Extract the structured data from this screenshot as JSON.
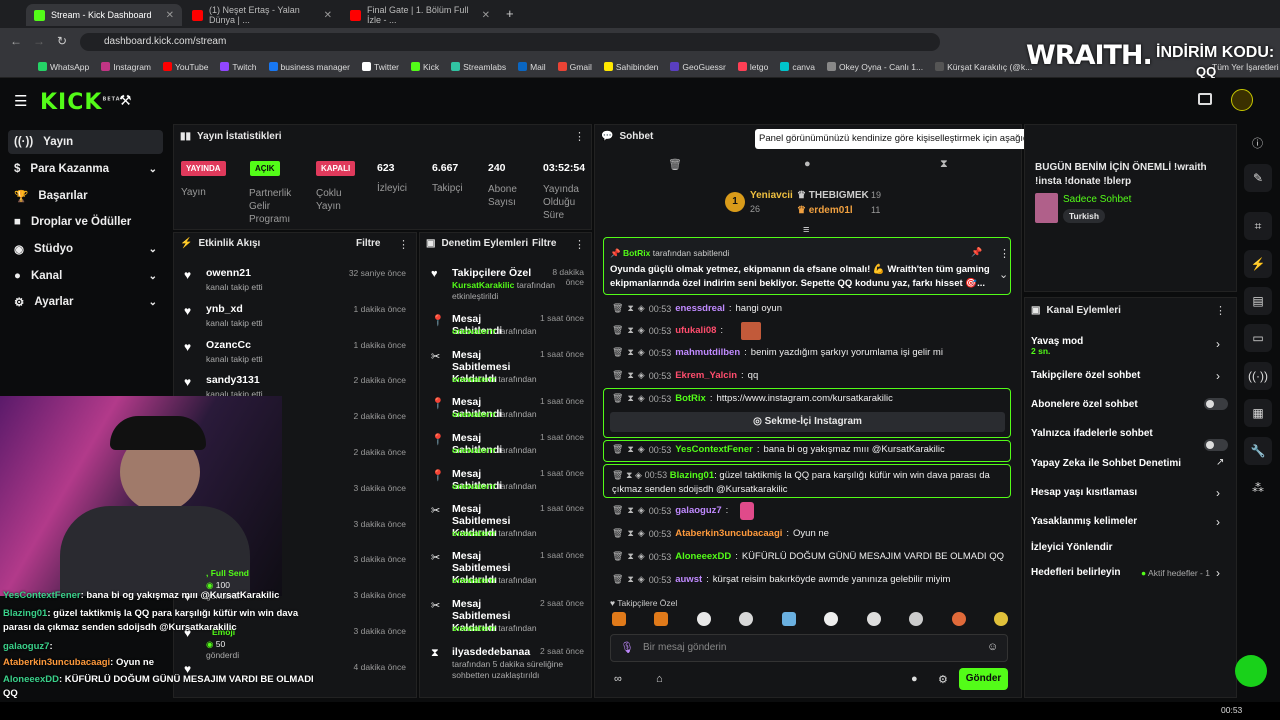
{
  "browser": {
    "tabs": [
      "Stream - Kick Dashboard",
      "(1) Neşet Ertaş - Yalan Dünya | ...",
      "Final Gate | 1. Bölüm Full İzle - ..."
    ],
    "url": "dashboard.kick.com/stream",
    "bookmarks": [
      "WhatsApp",
      "Instagram",
      "YouTube",
      "Twitch",
      "business manager",
      "Twitter",
      "Kick",
      "Streamlabs",
      "Mail",
      "Gmail",
      "Sahibinden",
      "GeoGuessr",
      "letgo",
      "canva",
      "Okey Oyna - Canlı 1...",
      "Kürşat Karakılıç (@k..."
    ],
    "bookmarks_more": "Tüm Yer İşaretleri"
  },
  "overlay": {
    "brand": "WRAITH.",
    "code_label": "İNDİRİM KODU:",
    "code": "QQ"
  },
  "kick": {
    "logo": "KICK",
    "beta": "BETA"
  },
  "sidebar": [
    {
      "label": "Yayın",
      "icon": "broadcast-icon"
    },
    {
      "label": "Para Kazanma",
      "icon": "dollar-icon"
    },
    {
      "label": "Başarılar",
      "icon": "trophy-icon"
    },
    {
      "label": "Droplar ve Ödüller",
      "icon": "gift-icon"
    },
    {
      "label": "Stüdyo",
      "icon": "studio-icon"
    },
    {
      "label": "Kanal",
      "icon": "user-icon"
    },
    {
      "label": "Ayarlar",
      "icon": "gear-icon"
    }
  ],
  "stats": {
    "title": "Yayın İstatistikleri",
    "items": [
      {
        "badge": "YAYINDA",
        "label": "Yayın",
        "color": "#e03a5c"
      },
      {
        "badge": "AÇIK",
        "label": "Partnerlik Gelir Programı",
        "color": "#53fc18"
      },
      {
        "badge": "KAPALI",
        "label": "Çoklu Yayın",
        "color": "#e03a5c"
      },
      {
        "value": "623",
        "label": "İzleyici"
      },
      {
        "value": "6.667",
        "label": "Takipçi"
      },
      {
        "value": "240",
        "label": "Abone Sayısı"
      },
      {
        "value": "03:52:54",
        "label": "Yayında Olduğu Süre"
      }
    ]
  },
  "activity": {
    "title": "Etkinlik Akışı",
    "filter": "Filtre",
    "items": [
      {
        "name": "owenn21",
        "sub": "kanalı takip etti",
        "time": "32 saniye önce"
      },
      {
        "name": "ynb_xd",
        "sub": "kanalı takip etti",
        "time": "1 dakika önce"
      },
      {
        "name": "OzancCc",
        "sub": "kanalı takip etti",
        "time": "1 dakika önce"
      },
      {
        "name": "sandy3131",
        "sub": "kanalı takip etti",
        "time": "2 dakika önce"
      },
      {
        "name": "",
        "sub": "",
        "time": "2 dakika önce"
      },
      {
        "name": "",
        "sub": "",
        "time": "2 dakika önce"
      },
      {
        "name": "",
        "sub": "",
        "time": "3 dakika önce"
      },
      {
        "name": "",
        "sub": "",
        "time": "3 dakika önce"
      },
      {
        "name": "",
        "sub": "",
        "time": "3 dakika önce"
      },
      {
        "name": "",
        "sub": "",
        "time": "3 dakika önce"
      },
      {
        "name": "",
        "sub": "",
        "time": "3 dakika önce"
      },
      {
        "name": "",
        "sub": "",
        "time": "4 dakika önce"
      }
    ],
    "gifts": [
      {
        "label": ", Full Send",
        "count": "100",
        "sent": "gönderdi"
      },
      {
        "label": "Emoji",
        "count": "50",
        "sent": "gönderdi"
      }
    ]
  },
  "moderation": {
    "title": "Denetim Eylemleri",
    "filter": "Filtre",
    "items": [
      {
        "title": "Takipçilere Özel",
        "by": "KursatKarakilic",
        "sub": "tarafından etkinleştirildi",
        "time": "8 dakika önce",
        "icon": "heart-icon"
      },
      {
        "title": "Mesaj Sabitlendi",
        "by": "onewaterrr",
        "sub": "tarafından",
        "time": "1 saat önce",
        "icon": "pin-icon"
      },
      {
        "title": "Mesaj Sabitlemesi Kaldırıldı",
        "by": "onewaterrr",
        "sub": "tarafından",
        "time": "1 saat önce",
        "icon": "unpin-icon"
      },
      {
        "title": "Mesaj Sabitlendi",
        "by": "onewaterrr",
        "sub": "tarafından",
        "time": "1 saat önce",
        "icon": "pin-icon"
      },
      {
        "title": "Mesaj Sabitlendi",
        "by": "onewaterrr",
        "sub": "tarafından",
        "time": "1 saat önce",
        "icon": "pin-icon"
      },
      {
        "title": "Mesaj Sabitlendi",
        "by": "onewaterrr",
        "sub": "tarafından",
        "time": "1 saat önce",
        "icon": "pin-icon"
      },
      {
        "title": "Mesaj Sabitlemesi Kaldırıldı",
        "by": "onewaterrr",
        "sub": "tarafından",
        "time": "1 saat önce",
        "icon": "unpin-icon"
      },
      {
        "title": "Mesaj Sabitlemesi Kaldırıldı",
        "by": "onewaterrr",
        "sub": "tarafından",
        "time": "1 saat önce",
        "icon": "unpin-icon"
      },
      {
        "title": "Mesaj Sabitlemesi Kaldırıldı",
        "by": "onewaterrr",
        "sub": "tarafından",
        "time": "2 saat önce",
        "icon": "unpin-icon"
      },
      {
        "title": "ilyasdedebanaa",
        "by": "",
        "sub": "tarafından 5 dakika süreliğine sohbetten uzaklaştırıldı",
        "time": "2 saat önce",
        "icon": "hourglass-icon"
      }
    ]
  },
  "chat": {
    "title": "Sohbet",
    "tooltip": "Panel görünümünüzü kendinize göre kişiselleştirmek için aşağıdaki ekran araçlarına tıklayın veya sürükleyin",
    "leaders": [
      {
        "rank": "1",
        "name": "Yeniavcii",
        "n": "26"
      },
      {
        "name": "THEBIGMEK",
        "n": "19"
      },
      {
        "name": "erdem01l",
        "n": "11"
      }
    ],
    "pinned": {
      "user": "BotRix",
      "by": "tarafından sabitlendi",
      "text": "Oyunda güçlü olmak yetmez, ekipmanın da efsane olmalı! 💪 Wraith'ten tüm gaming ekipmanlarında özel indirim seni bekliyor. Sepette QQ kodunu yaz, farkı hisset 🎯..."
    },
    "messages": [
      {
        "ts": "00:53",
        "user": "enessdreal",
        "color": "#c08aff",
        "text": "hangi oyun"
      },
      {
        "ts": "00:53",
        "user": "ufukali08",
        "color": "#ff4d6d",
        "text": ""
      },
      {
        "ts": "00:53",
        "user": "mahmutdilben",
        "color": "#c08aff",
        "text": "benim yazdığım şarkıyı yorumlama işi gelir mi"
      },
      {
        "ts": "00:53",
        "user": "Ekrem_Yalcin",
        "color": "#ff4d6d",
        "text": "qq"
      },
      {
        "ts": "00:53",
        "user": "BotRix",
        "color": "#53fc18",
        "text": "https://www.instagram.com/kursatkarakilic"
      },
      {
        "ts": "00:53",
        "user": "YesContextFener",
        "color": "#53fc18",
        "text": "bana bi og yakışmaz mııı @KursatKarakilic"
      },
      {
        "ts": "00:53",
        "user": "Blazing01",
        "color": "#53fc18",
        "text": "güzel taktikmiş la QQ para karşılığı küfür win win dava parası da çıkmaz senden sdoijsdh @Kursatkarakilic"
      },
      {
        "ts": "00:53",
        "user": "galaoguz7",
        "color": "#c08aff",
        "text": ""
      },
      {
        "ts": "00:53",
        "user": "Ataberkin3uncubacaagi",
        "color": "#ff9a3c",
        "text": "Oyun ne"
      },
      {
        "ts": "00:53",
        "user": "AloneeexDD",
        "color": "#53fc18",
        "text": "KÜFÜRLÜ DOĞUM GÜNÜ MESAJIM VARDI BE OLMADI QQ"
      },
      {
        "ts": "00:53",
        "user": "auwst",
        "color": "#c08aff",
        "text": "kürşat reisim bakırköyde awmde yanınıza gelebilir miyim"
      }
    ],
    "instagram_button": "Sekme-İçi Instagram",
    "followers_only": "Takipçilere Özel",
    "placeholder": "Bir mesaj gönderin",
    "send": "Gönder"
  },
  "info": {
    "title": "BUGÜN BENİM İÇİN ÖNEMLİ !wraith !insta !donate !blerp",
    "category": "Sadece Sohbet",
    "tag": "Turkish"
  },
  "channel": {
    "title": "Kanal Eylemleri",
    "items": [
      {
        "label": "Yavaş mod",
        "sub": "2 sn.",
        "ctrl": "chevron"
      },
      {
        "label": "Takipçilere özel sohbet",
        "ctrl": "chevron"
      },
      {
        "label": "Abonelere özel sohbet",
        "ctrl": "toggle"
      },
      {
        "label": "Yalnızca ifadelerle sohbet",
        "ctrl": "toggle"
      },
      {
        "label": "Yapay Zeka ile Sohbet Denetimi",
        "ctrl": "external"
      },
      {
        "label": "Hesap yaşı kısıtlaması",
        "ctrl": "chevron"
      },
      {
        "label": "Yasaklanmış kelimeler",
        "ctrl": "chevron"
      },
      {
        "label": "İzleyici Yönlendir",
        "ctrl": "none"
      },
      {
        "label": "Hedefleri belirleyin",
        "ctrl": "goal",
        "extra": "Aktif hedefler - 1"
      }
    ]
  },
  "overlay_chat": [
    {
      "user": "YesContextFener",
      "text": ": bana bi og yakışmaz mııı @KursatKarakilic",
      "color": "#3ad18a"
    },
    {
      "user": "Blazing01",
      "text": ": güzel taktikmiş la QQ para karşılığı küfür win win dava",
      "color": "#3ad18a"
    },
    {
      "user": "",
      "text": "parası da çıkmaz senden sdoijsdh @Kursatkarakilic",
      "color": "#fff"
    },
    {
      "user": "galaoguz7",
      "text": ":",
      "color": "#3ad18a"
    },
    {
      "user": "Ataberkin3uncubacaagi",
      "text": ": Oyun ne",
      "color": "#ff9a3c"
    },
    {
      "user": "AloneeexDD",
      "text": ": KÜFÜRLÜ DOĞUM GÜNÜ MESAJIM VARDI BE OLMADI",
      "color": "#3ad18a"
    },
    {
      "user": "",
      "text": "QQ",
      "color": "#fff"
    },
    {
      "user": "auwst",
      "text": ": kürşat reisim bakırköyde awmde yanınıza gelebilir miyim",
      "color": "#c08aff"
    }
  ],
  "taskbar": {
    "clock": "00:53"
  }
}
